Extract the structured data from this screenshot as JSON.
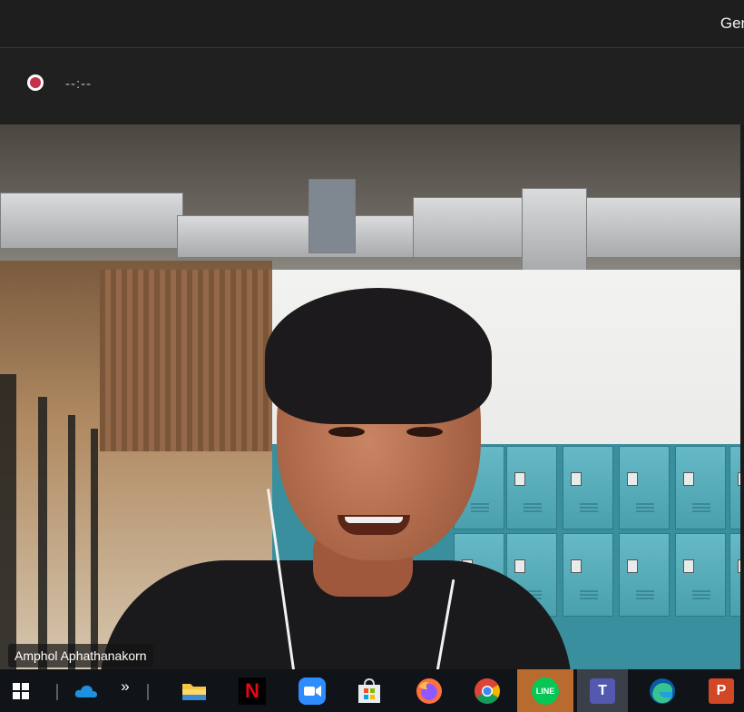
{
  "window": {
    "title": "Gen"
  },
  "recording": {
    "timer": "--:--",
    "color": "#c4314b"
  },
  "participant": {
    "name": "Amphol Aphathanakorn"
  },
  "taskbar": {
    "overflow_label": "»",
    "apps": [
      {
        "name": "windows-start",
        "icon": "windows-icon"
      },
      {
        "name": "onedrive",
        "icon": "cloud-icon"
      },
      {
        "name": "file-explorer",
        "icon": "folder-icon"
      },
      {
        "name": "netflix",
        "icon": "netflix-icon",
        "glyph": "N"
      },
      {
        "name": "zoom",
        "icon": "zoom-icon"
      },
      {
        "name": "microsoft-store",
        "icon": "store-icon"
      },
      {
        "name": "firefox",
        "icon": "firefox-icon"
      },
      {
        "name": "chrome",
        "icon": "chrome-icon"
      },
      {
        "name": "line",
        "icon": "line-icon",
        "glyph": "LINE"
      },
      {
        "name": "teams",
        "icon": "teams-icon",
        "glyph": "T"
      },
      {
        "name": "edge",
        "icon": "edge-icon"
      },
      {
        "name": "powerpoint",
        "icon": "powerpoint-icon",
        "glyph": "P"
      }
    ]
  }
}
